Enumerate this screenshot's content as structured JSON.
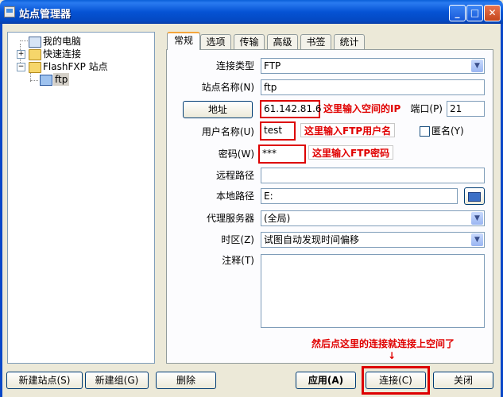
{
  "window": {
    "title": "站点管理器",
    "controls": {
      "minimize": "_",
      "maximize": "□",
      "close": "✕"
    }
  },
  "tree": {
    "items": [
      {
        "label": "我的电脑",
        "icon": "computer-icon"
      },
      {
        "label": "快速连接",
        "icon": "folder-icon",
        "expander": "+"
      },
      {
        "label": "FlashFXP 站点",
        "icon": "folder-icon",
        "expander": "−"
      },
      {
        "label": "ftp",
        "icon": "monitor-icon",
        "selected": true
      }
    ]
  },
  "tabs": [
    {
      "label": "常规",
      "active": true
    },
    {
      "label": "选项"
    },
    {
      "label": "传输"
    },
    {
      "label": "高级"
    },
    {
      "label": "书签"
    },
    {
      "label": "统计"
    }
  ],
  "form": {
    "connection_type": {
      "label": "连接类型",
      "value": "FTP"
    },
    "site_name": {
      "label": "站点名称(N)",
      "value": "ftp"
    },
    "address": {
      "button": "地址",
      "value": "61.142.81.6"
    },
    "port": {
      "label": "端口(P)",
      "value": "21"
    },
    "username": {
      "label": "用户名称(U)",
      "value": "test"
    },
    "anonymous": {
      "label": "匿名(Y)",
      "checked": false
    },
    "password": {
      "label": "密码(W)",
      "value": "***"
    },
    "remote_path": {
      "label": "远程路径",
      "value": ""
    },
    "local_path": {
      "label": "本地路径",
      "value": "E:"
    },
    "proxy": {
      "label": "代理服务器",
      "value": "(全局)"
    },
    "timezone": {
      "label": "时区(Z)",
      "value": "试图自动发现时间偏移"
    },
    "notes": {
      "label": "注释(T)",
      "value": ""
    }
  },
  "annotations": {
    "ip": "这里输入空间的IP",
    "user": "这里输入FTP用户名",
    "password": "这里输入FTP密码",
    "connect": "然后点这里的连接就连接上空间了",
    "arrow": "↓"
  },
  "buttons": {
    "new_site": "新建站点(S)",
    "new_group": "新建组(G)",
    "delete": "删除",
    "apply": "应用(A)",
    "connect": "连接(C)",
    "close": "关闭"
  },
  "colors": {
    "annotation": "#e00000",
    "titlebar": "#0553d4",
    "active_tab_accent": "#f5a53b"
  }
}
